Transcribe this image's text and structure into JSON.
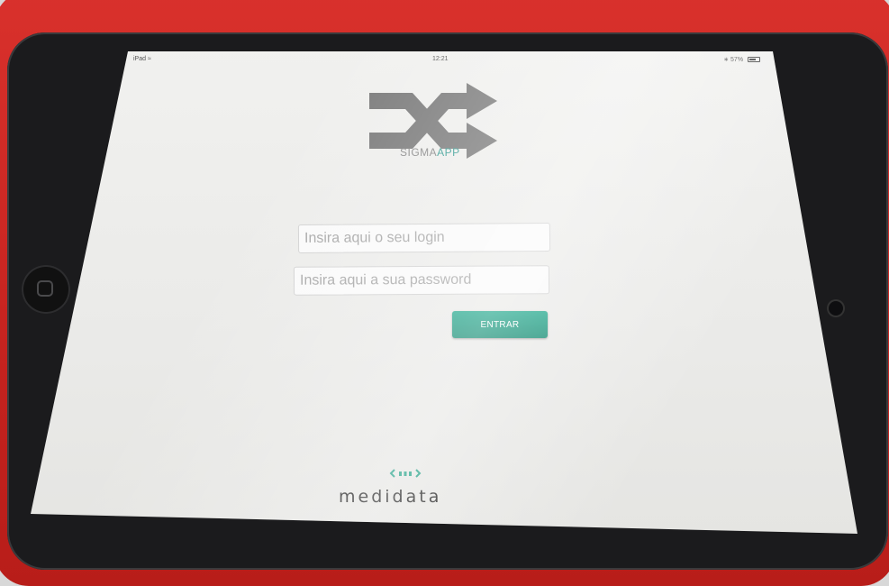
{
  "status_bar": {
    "device": "iPad",
    "time": "12:21",
    "battery": "57%"
  },
  "logo": {
    "brand_part1": "SIGMA",
    "brand_part2": "APP",
    "icon": "shuffle-icon",
    "icon_color": "#7a7a7a",
    "accent_color": "#3a9e95"
  },
  "form": {
    "login_placeholder": "Insira aqui o seu login",
    "login_value": "",
    "password_placeholder": "Insira aqui a sua password",
    "password_value": "",
    "submit_label": "ENTRAR",
    "submit_color": "#1e9e84"
  },
  "footer": {
    "company_icon": "medidata-logo-icon",
    "company_name": "medidata"
  }
}
